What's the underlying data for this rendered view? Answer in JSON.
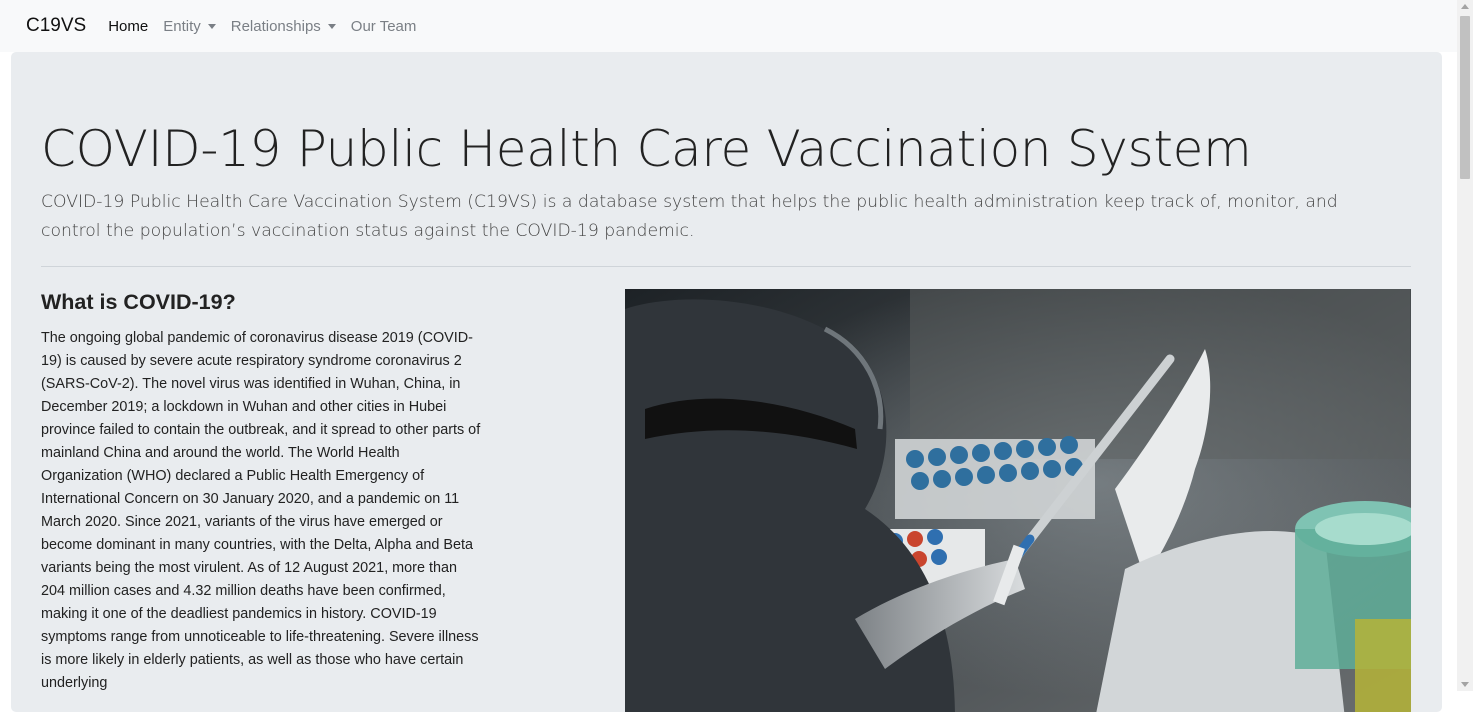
{
  "navbar": {
    "brand": "C19VS",
    "items": [
      {
        "label": "Home",
        "active": true,
        "dropdown": false
      },
      {
        "label": "Entity",
        "active": false,
        "dropdown": true
      },
      {
        "label": "Relationships",
        "active": false,
        "dropdown": true
      },
      {
        "label": "Our Team",
        "active": false,
        "dropdown": false
      }
    ]
  },
  "hero": {
    "title": "COVID-19 Public Health Care Vaccination System",
    "lead": "COVID-19 Public Health Care Vaccination System (C19VS) is a database system that helps the public health administration keep track of, monitor, and control the population’s vaccination status against the COVID-19 pandemic."
  },
  "section": {
    "title": "What is COVID-19?",
    "body": "The ongoing global pandemic of coronavirus disease 2019 (COVID-19) is caused by severe acute respiratory syndrome coronavirus 2 (SARS-CoV-2). The novel virus was identified in Wuhan, China, in December 2019; a lockdown in Wuhan and other cities in Hubei province failed to contain the outbreak, and it spread to other parts of mainland China and around the world. The World Health Organization (WHO) declared a Public Health Emergency of International Concern on 30 January 2020, and a pandemic on 11 March 2020. Since 2021, variants of the virus have emerged or become dominant in many countries, with the Delta, Alpha and Beta variants being the most virulent. As of 12 August 2021, more than 204 million cases and 4.32 million deaths have been confirmed, making it one of the deadliest pandemics in history. COVID-19 symptoms range from unnoticeable to life-threatening. Severe illness is more likely in elderly patients, as well as those who have certain underlying"
  },
  "colors": {
    "navbar_bg": "#f8f9fa",
    "jumbotron_bg": "#e9ecef",
    "nav_inactive": "#7a7f85"
  },
  "icons": {
    "dropdown": "caret-down-icon"
  }
}
